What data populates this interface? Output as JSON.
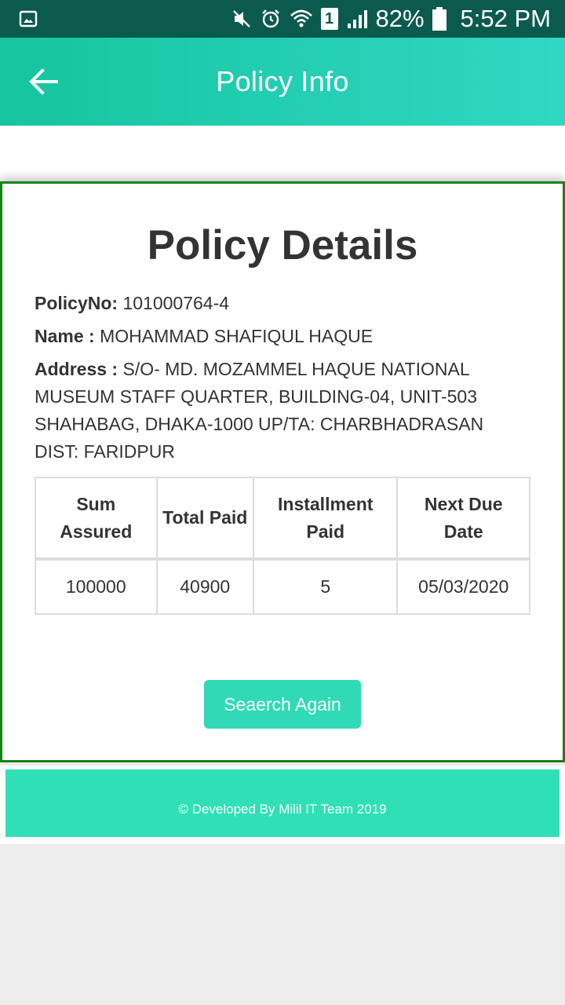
{
  "status_bar": {
    "battery": "82%",
    "time": "5:52 PM",
    "sim_slot": "1",
    "icons": [
      "gallery-icon",
      "mute-icon",
      "alarm-icon",
      "wifi-icon",
      "sim-icon",
      "signal-icon",
      "battery-icon"
    ]
  },
  "app_bar": {
    "title": "Policy Info",
    "back_icon": "arrow-left-icon"
  },
  "card": {
    "heading": "Policy Details",
    "policy_no_label": "PolicyNo:",
    "policy_no": "101000764-4",
    "name_label": "Name :",
    "name": "MOHAMMAD SHAFIQUL HAQUE",
    "address_label": "Address :",
    "address": "S/O- MD. MOZAMMEL HAQUE NATIONAL MUSEUM STAFF QUARTER, BUILDING-04, UNIT-503 SHAHABAG, DHAKA-1000 UP/TA: CHARBHADRASAN DIST: FARIDPUR"
  },
  "table": {
    "headers": [
      "Sum Assured",
      "Total Paid",
      "Installment Paid",
      "Next Due Date"
    ],
    "row": [
      "100000",
      "40900",
      "5",
      "05/03/2020"
    ]
  },
  "button": {
    "label": "Seaerch Again"
  },
  "footer": {
    "text": "© Developed By Milil IT Team 2019"
  },
  "colors": {
    "status_bar": "#0b5a4e",
    "app_bar_start": "#16c4a0",
    "app_bar_end": "#2fd8c3",
    "card_border": "#148414",
    "button": "#30dab6",
    "footer": "#2fe0b6"
  }
}
